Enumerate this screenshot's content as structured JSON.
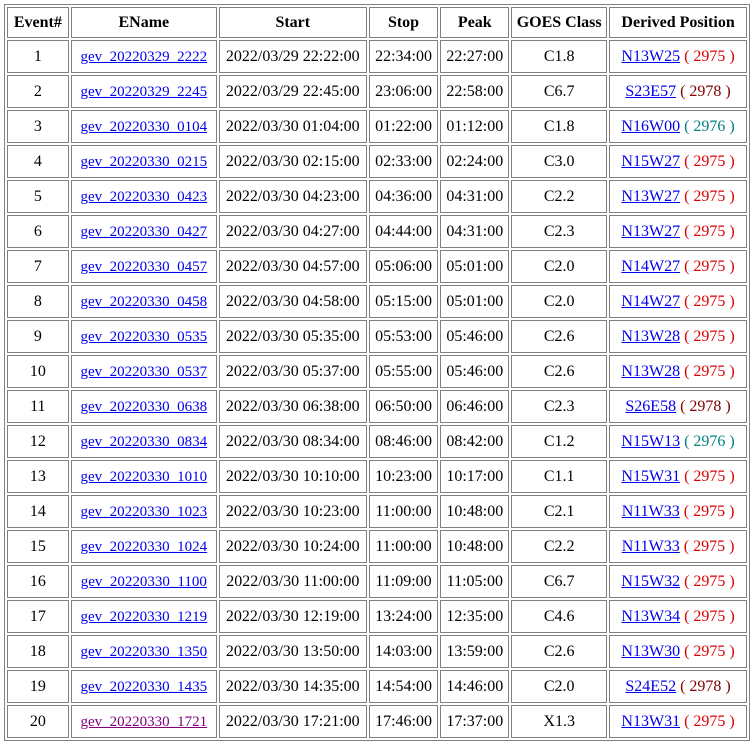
{
  "headers": [
    "Event#",
    "EName",
    "Start",
    "Stop",
    "Peak",
    "GOES Class",
    "Derived Position"
  ],
  "colors": {
    "link": "#0000ee",
    "visited_link": "#800080",
    "ar_2975": "#dd0000",
    "ar_2978": "#800000",
    "ar_2976": "#008080",
    "border": "#808080"
  },
  "rows": [
    {
      "event": "1",
      "ename": "gev_20220329_2222",
      "start": "2022/03/29 22:22:00",
      "stop": "22:34:00",
      "peak": "22:27:00",
      "goes_class": "C1.8",
      "position": "N13W25",
      "ar_open": " ( ",
      "ar": "2975",
      "ar_close": " )",
      "ar_color": "#dd0000",
      "visited": false
    },
    {
      "event": "2",
      "ename": "gev_20220329_2245",
      "start": "2022/03/29 22:45:00",
      "stop": "23:06:00",
      "peak": "22:58:00",
      "goes_class": "C6.7",
      "position": "S23E57",
      "ar_open": " ( ",
      "ar": "2978",
      "ar_close": " )",
      "ar_color": "#800000",
      "visited": false
    },
    {
      "event": "3",
      "ename": "gev_20220330_0104",
      "start": "2022/03/30 01:04:00",
      "stop": "01:22:00",
      "peak": "01:12:00",
      "goes_class": "C1.8",
      "position": "N16W00",
      "ar_open": " ( ",
      "ar": "2976",
      "ar_close": " )",
      "ar_color": "#008080",
      "visited": false
    },
    {
      "event": "4",
      "ename": "gev_20220330_0215",
      "start": "2022/03/30 02:15:00",
      "stop": "02:33:00",
      "peak": "02:24:00",
      "goes_class": "C3.0",
      "position": "N15W27",
      "ar_open": " ( ",
      "ar": "2975",
      "ar_close": " )",
      "ar_color": "#dd0000",
      "visited": false
    },
    {
      "event": "5",
      "ename": "gev_20220330_0423",
      "start": "2022/03/30 04:23:00",
      "stop": "04:36:00",
      "peak": "04:31:00",
      "goes_class": "C2.2",
      "position": "N13W27",
      "ar_open": " ( ",
      "ar": "2975",
      "ar_close": " )",
      "ar_color": "#dd0000",
      "visited": false
    },
    {
      "event": "6",
      "ename": "gev_20220330_0427",
      "start": "2022/03/30 04:27:00",
      "stop": "04:44:00",
      "peak": "04:31:00",
      "goes_class": "C2.3",
      "position": "N13W27",
      "ar_open": " ( ",
      "ar": "2975",
      "ar_close": " )",
      "ar_color": "#dd0000",
      "visited": false
    },
    {
      "event": "7",
      "ename": "gev_20220330_0457",
      "start": "2022/03/30 04:57:00",
      "stop": "05:06:00",
      "peak": "05:01:00",
      "goes_class": "C2.0",
      "position": "N14W27",
      "ar_open": " ( ",
      "ar": "2975",
      "ar_close": " )",
      "ar_color": "#dd0000",
      "visited": false
    },
    {
      "event": "8",
      "ename": "gev_20220330_0458",
      "start": "2022/03/30 04:58:00",
      "stop": "05:15:00",
      "peak": "05:01:00",
      "goes_class": "C2.0",
      "position": "N14W27",
      "ar_open": " ( ",
      "ar": "2975",
      "ar_close": " )",
      "ar_color": "#dd0000",
      "visited": false
    },
    {
      "event": "9",
      "ename": "gev_20220330_0535",
      "start": "2022/03/30 05:35:00",
      "stop": "05:53:00",
      "peak": "05:46:00",
      "goes_class": "C2.6",
      "position": "N13W28",
      "ar_open": " ( ",
      "ar": "2975",
      "ar_close": " )",
      "ar_color": "#dd0000",
      "visited": false
    },
    {
      "event": "10",
      "ename": "gev_20220330_0537",
      "start": "2022/03/30 05:37:00",
      "stop": "05:55:00",
      "peak": "05:46:00",
      "goes_class": "C2.6",
      "position": "N13W28",
      "ar_open": " ( ",
      "ar": "2975",
      "ar_close": " )",
      "ar_color": "#dd0000",
      "visited": false
    },
    {
      "event": "11",
      "ename": "gev_20220330_0638",
      "start": "2022/03/30 06:38:00",
      "stop": "06:50:00",
      "peak": "06:46:00",
      "goes_class": "C2.3",
      "position": "S26E58",
      "ar_open": " ( ",
      "ar": "2978",
      "ar_close": " )",
      "ar_color": "#800000",
      "visited": false
    },
    {
      "event": "12",
      "ename": "gev_20220330_0834",
      "start": "2022/03/30 08:34:00",
      "stop": "08:46:00",
      "peak": "08:42:00",
      "goes_class": "C1.2",
      "position": "N15W13",
      "ar_open": " ( ",
      "ar": "2976",
      "ar_close": " )",
      "ar_color": "#008080",
      "visited": false
    },
    {
      "event": "13",
      "ename": "gev_20220330_1010",
      "start": "2022/03/30 10:10:00",
      "stop": "10:23:00",
      "peak": "10:17:00",
      "goes_class": "C1.1",
      "position": "N15W31",
      "ar_open": " ( ",
      "ar": "2975",
      "ar_close": " )",
      "ar_color": "#dd0000",
      "visited": false
    },
    {
      "event": "14",
      "ename": "gev_20220330_1023",
      "start": "2022/03/30 10:23:00",
      "stop": "11:00:00",
      "peak": "10:48:00",
      "goes_class": "C2.1",
      "position": "N11W33",
      "ar_open": " ( ",
      "ar": "2975",
      "ar_close": " )",
      "ar_color": "#dd0000",
      "visited": false
    },
    {
      "event": "15",
      "ename": "gev_20220330_1024",
      "start": "2022/03/30 10:24:00",
      "stop": "11:00:00",
      "peak": "10:48:00",
      "goes_class": "C2.2",
      "position": "N11W33",
      "ar_open": " ( ",
      "ar": "2975",
      "ar_close": " )",
      "ar_color": "#dd0000",
      "visited": false
    },
    {
      "event": "16",
      "ename": "gev_20220330_1100",
      "start": "2022/03/30 11:00:00",
      "stop": "11:09:00",
      "peak": "11:05:00",
      "goes_class": "C6.7",
      "position": "N15W32",
      "ar_open": " ( ",
      "ar": "2975",
      "ar_close": " )",
      "ar_color": "#dd0000",
      "visited": false
    },
    {
      "event": "17",
      "ename": "gev_20220330_1219",
      "start": "2022/03/30 12:19:00",
      "stop": "13:24:00",
      "peak": "12:35:00",
      "goes_class": "C4.6",
      "position": "N13W34",
      "ar_open": " ( ",
      "ar": "2975",
      "ar_close": " )",
      "ar_color": "#dd0000",
      "visited": false
    },
    {
      "event": "18",
      "ename": "gev_20220330_1350",
      "start": "2022/03/30 13:50:00",
      "stop": "14:03:00",
      "peak": "13:59:00",
      "goes_class": "C2.6",
      "position": "N13W30",
      "ar_open": " ( ",
      "ar": "2975",
      "ar_close": " )",
      "ar_color": "#dd0000",
      "visited": false
    },
    {
      "event": "19",
      "ename": "gev_20220330_1435",
      "start": "2022/03/30 14:35:00",
      "stop": "14:54:00",
      "peak": "14:46:00",
      "goes_class": "C2.0",
      "position": "S24E52",
      "ar_open": " ( ",
      "ar": "2978",
      "ar_close": " )",
      "ar_color": "#800000",
      "visited": false
    },
    {
      "event": "20",
      "ename": "gev_20220330_1721",
      "start": "2022/03/30 17:21:00",
      "stop": "17:46:00",
      "peak": "17:37:00",
      "goes_class": "X1.3",
      "position": "N13W31",
      "ar_open": " ( ",
      "ar": "2975",
      "ar_close": " )",
      "ar_color": "#dd0000",
      "visited": true
    }
  ]
}
